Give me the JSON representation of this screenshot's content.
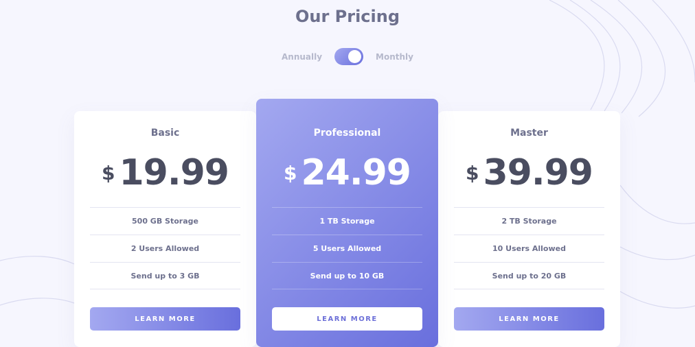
{
  "header": {
    "title": "Our Pricing"
  },
  "billing_toggle": {
    "left_label": "Annually",
    "right_label": "Monthly",
    "selected": "Monthly"
  },
  "plans": [
    {
      "name": "Basic",
      "currency": "$",
      "price": "19.99",
      "features": [
        "500 GB Storage",
        "2 Users Allowed",
        "Send up to 3 GB"
      ],
      "button_label": "LEARN MORE"
    },
    {
      "name": "Professional",
      "currency": "$",
      "price": "24.99",
      "features": [
        "1 TB Storage",
        "5 Users Allowed",
        "Send up to 10 GB"
      ],
      "button_label": "LEARN MORE"
    },
    {
      "name": "Master",
      "currency": "$",
      "price": "39.99",
      "features": [
        "2 TB Storage",
        "10 Users Allowed",
        "Send up to 20 GB"
      ],
      "button_label": "LEARN MORE"
    }
  ],
  "colors": {
    "background": "#f6f6fe",
    "accent_light": "#a3a8f0",
    "accent_dark": "#696fdd",
    "heading": "#6d708d",
    "price": "#4a4d60"
  }
}
